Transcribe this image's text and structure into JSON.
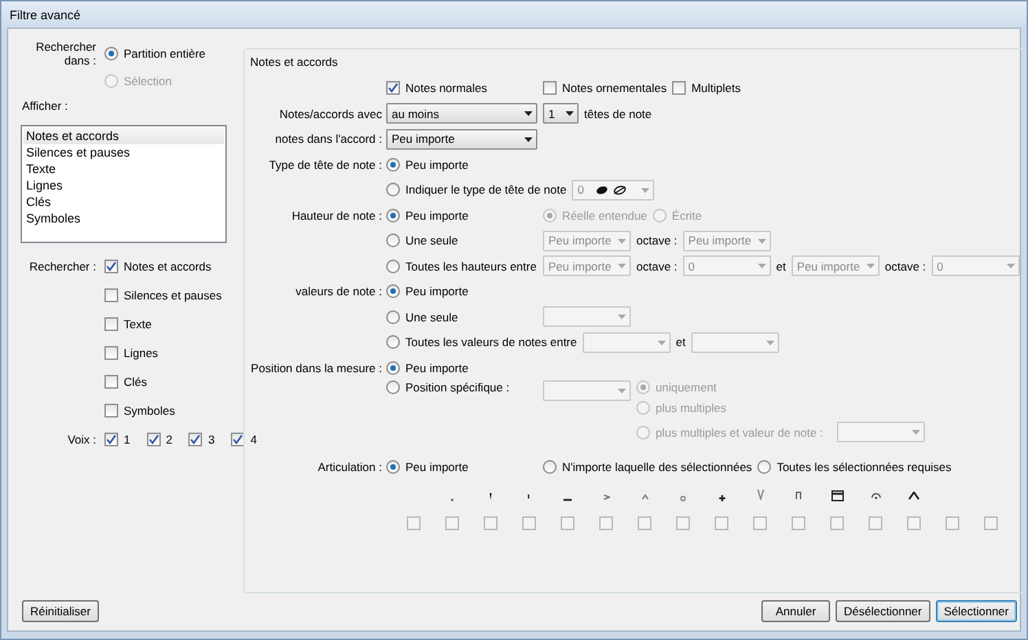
{
  "window": {
    "title": "Filtre avancé"
  },
  "search_in": {
    "label": "Rechercher dans :",
    "options": [
      {
        "label": "Partition entière",
        "selected": true,
        "disabled": false
      },
      {
        "label": "Sélection",
        "selected": false,
        "disabled": true
      }
    ]
  },
  "display": {
    "label": "Afficher :",
    "items": [
      {
        "label": "Notes et accords",
        "selected": true
      },
      {
        "label": "Silences et pauses",
        "selected": false
      },
      {
        "label": "Texte",
        "selected": false
      },
      {
        "label": "Lignes",
        "selected": false
      },
      {
        "label": "Clés",
        "selected": false
      },
      {
        "label": "Symboles",
        "selected": false
      }
    ]
  },
  "search_for": {
    "label": "Rechercher :",
    "items": [
      {
        "label": "Notes et accords",
        "checked": true
      },
      {
        "label": "Silences et pauses",
        "checked": false
      },
      {
        "label": "Texte",
        "checked": false
      },
      {
        "label": "Lignes",
        "checked": false
      },
      {
        "label": "Clés",
        "checked": false
      },
      {
        "label": "Symboles",
        "checked": false
      }
    ]
  },
  "voices": {
    "label": "Voix :",
    "items": [
      {
        "label": "1",
        "checked": true
      },
      {
        "label": "2",
        "checked": true
      },
      {
        "label": "3",
        "checked": true
      },
      {
        "label": "4",
        "checked": true
      }
    ]
  },
  "group": {
    "title": "Notes et accords",
    "rows": [
      {
        "items": [
          {
            "kind": "checkbox",
            "label": "Notes normales",
            "checked": true
          },
          {
            "kind": "checkbox",
            "label": "Notes ornementales",
            "checked": false
          },
          {
            "kind": "checkbox",
            "label": "Multiplets",
            "checked": false
          }
        ]
      },
      {
        "label": "Notes/accords avec",
        "items": [
          {
            "kind": "select",
            "value": "au moins",
            "disabled": false
          },
          {
            "kind": "select",
            "value": "1",
            "disabled": false
          },
          {
            "kind": "text",
            "label": "têtes de note"
          }
        ]
      },
      {
        "label": "notes dans l'accord :",
        "items": [
          {
            "kind": "select",
            "value": "Peu importe",
            "disabled": false
          }
        ]
      },
      {
        "label": "Type de tête de note :",
        "items": [
          {
            "kind": "radio",
            "label": "Peu importe",
            "selected": true,
            "disabled": false
          }
        ]
      },
      {
        "items": [
          {
            "kind": "radio",
            "label": "Indiquer le type de tête de note",
            "selected": false,
            "disabled": false
          },
          {
            "kind": "notehead",
            "value": "0",
            "disabled": true
          }
        ]
      },
      {
        "label": "Hauteur de note :",
        "items": [
          {
            "kind": "radio",
            "label": "Peu importe",
            "selected": true,
            "disabled": false
          },
          {
            "kind": "radio",
            "label": "Réelle entendue",
            "selected": true,
            "disabled": true
          },
          {
            "kind": "radio",
            "label": "Écrite",
            "selected": false,
            "disabled": true
          }
        ]
      },
      {
        "items": [
          {
            "kind": "radio",
            "label": "Une seule",
            "selected": false,
            "disabled": false
          },
          {
            "kind": "select",
            "value": "Peu importe",
            "disabled": true
          },
          {
            "kind": "text",
            "label": "octave :"
          },
          {
            "kind": "select",
            "value": "Peu importe",
            "disabled": true
          }
        ]
      },
      {
        "items": [
          {
            "kind": "radio",
            "label": "Toutes les hauteurs entre",
            "selected": false,
            "disabled": false
          },
          {
            "kind": "select",
            "value": "Peu importe",
            "disabled": true
          },
          {
            "kind": "text",
            "label": "octave :"
          },
          {
            "kind": "select",
            "value": "0",
            "disabled": true
          },
          {
            "kind": "text",
            "label": "et"
          },
          {
            "kind": "select",
            "value": "Peu importe",
            "disabled": true
          },
          {
            "kind": "text",
            "label": "octave :"
          },
          {
            "kind": "select",
            "value": "0",
            "disabled": true
          }
        ]
      },
      {
        "label": "valeurs de note :",
        "items": [
          {
            "kind": "radio",
            "label": "Peu importe",
            "selected": true,
            "disabled": false
          }
        ]
      },
      {
        "items": [
          {
            "kind": "radio",
            "label": "Une seule",
            "selected": false,
            "disabled": false
          },
          {
            "kind": "select",
            "disabled": true
          }
        ]
      },
      {
        "items": [
          {
            "kind": "radio",
            "label": "Toutes les valeurs de notes entre",
            "selected": false,
            "disabled": false
          },
          {
            "kind": "select",
            "disabled": true
          },
          {
            "kind": "text",
            "label": "et"
          },
          {
            "kind": "select",
            "disabled": true
          }
        ]
      },
      {
        "label": "Position dans la mesure :",
        "items": [
          {
            "kind": "radio",
            "label": "Peu importe",
            "selected": true,
            "disabled": false
          }
        ]
      },
      {
        "items": [
          {
            "kind": "radio",
            "label": "Position spécifique :",
            "selected": false,
            "disabled": false
          },
          {
            "kind": "select",
            "disabled": true
          },
          {
            "kind": "stack",
            "items": [
              {
                "kind": "radio",
                "label": "uniquement",
                "selected": true,
                "disabled": true
              },
              {
                "kind": "radio",
                "label": "plus multiples",
                "selected": false,
                "disabled": true
              },
              {
                "kind": "radio",
                "label": "plus multiples et valeur de note :",
                "selected": false,
                "disabled": true
              },
              {
                "kind": "select",
                "disabled": true
              }
            ]
          }
        ]
      },
      {
        "label": "Articulation :",
        "items": [
          {
            "kind": "radio",
            "label": "Peu importe",
            "selected": true,
            "disabled": false
          },
          {
            "kind": "radio",
            "label": "N'importe laquelle des sélectionnées",
            "selected": false,
            "disabled": false
          },
          {
            "kind": "radio",
            "label": "Toutes les sélectionnées requises",
            "selected": false,
            "disabled": false
          }
        ]
      }
    ]
  },
  "articulations": [
    {
      "kind": "none",
      "checked": false
    },
    {
      "kind": "dot",
      "checked": false
    },
    {
      "kind": "wedge",
      "checked": false
    },
    {
      "kind": "tick",
      "checked": false
    },
    {
      "kind": "dash",
      "checked": false
    },
    {
      "kind": "angle",
      "checked": false
    },
    {
      "kind": "caret",
      "checked": false
    },
    {
      "kind": "ring",
      "checked": false
    },
    {
      "kind": "plus",
      "checked": false
    },
    {
      "kind": "v",
      "checked": false
    },
    {
      "kind": "bow",
      "checked": false
    },
    {
      "kind": "boxed",
      "checked": false
    },
    {
      "kind": "circle-dot",
      "checked": false
    },
    {
      "kind": "chevron",
      "checked": false
    },
    {
      "kind": "none",
      "checked": false
    },
    {
      "kind": "none",
      "checked": false
    }
  ],
  "buttons": {
    "reset": "Réinitialiser",
    "actions": [
      {
        "label": "Annuler",
        "default": false
      },
      {
        "label": "Désélectionner",
        "default": false
      },
      {
        "label": "Sélectionner",
        "default": true
      }
    ]
  }
}
